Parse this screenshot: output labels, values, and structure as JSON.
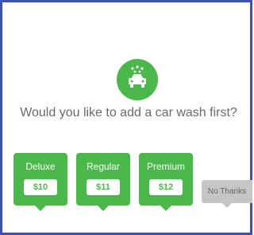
{
  "prompt": {
    "question": "Would you like to add a car wash first?",
    "icon": "car-wash-icon",
    "accent_color": "#4cb84b"
  },
  "options": [
    {
      "name": "Deluxe",
      "price": "$10"
    },
    {
      "name": "Regular",
      "price": "$11"
    },
    {
      "name": "Premium",
      "price": "$12"
    }
  ],
  "decline": {
    "label": "No Thanks",
    "color": "#c6c6c6"
  }
}
